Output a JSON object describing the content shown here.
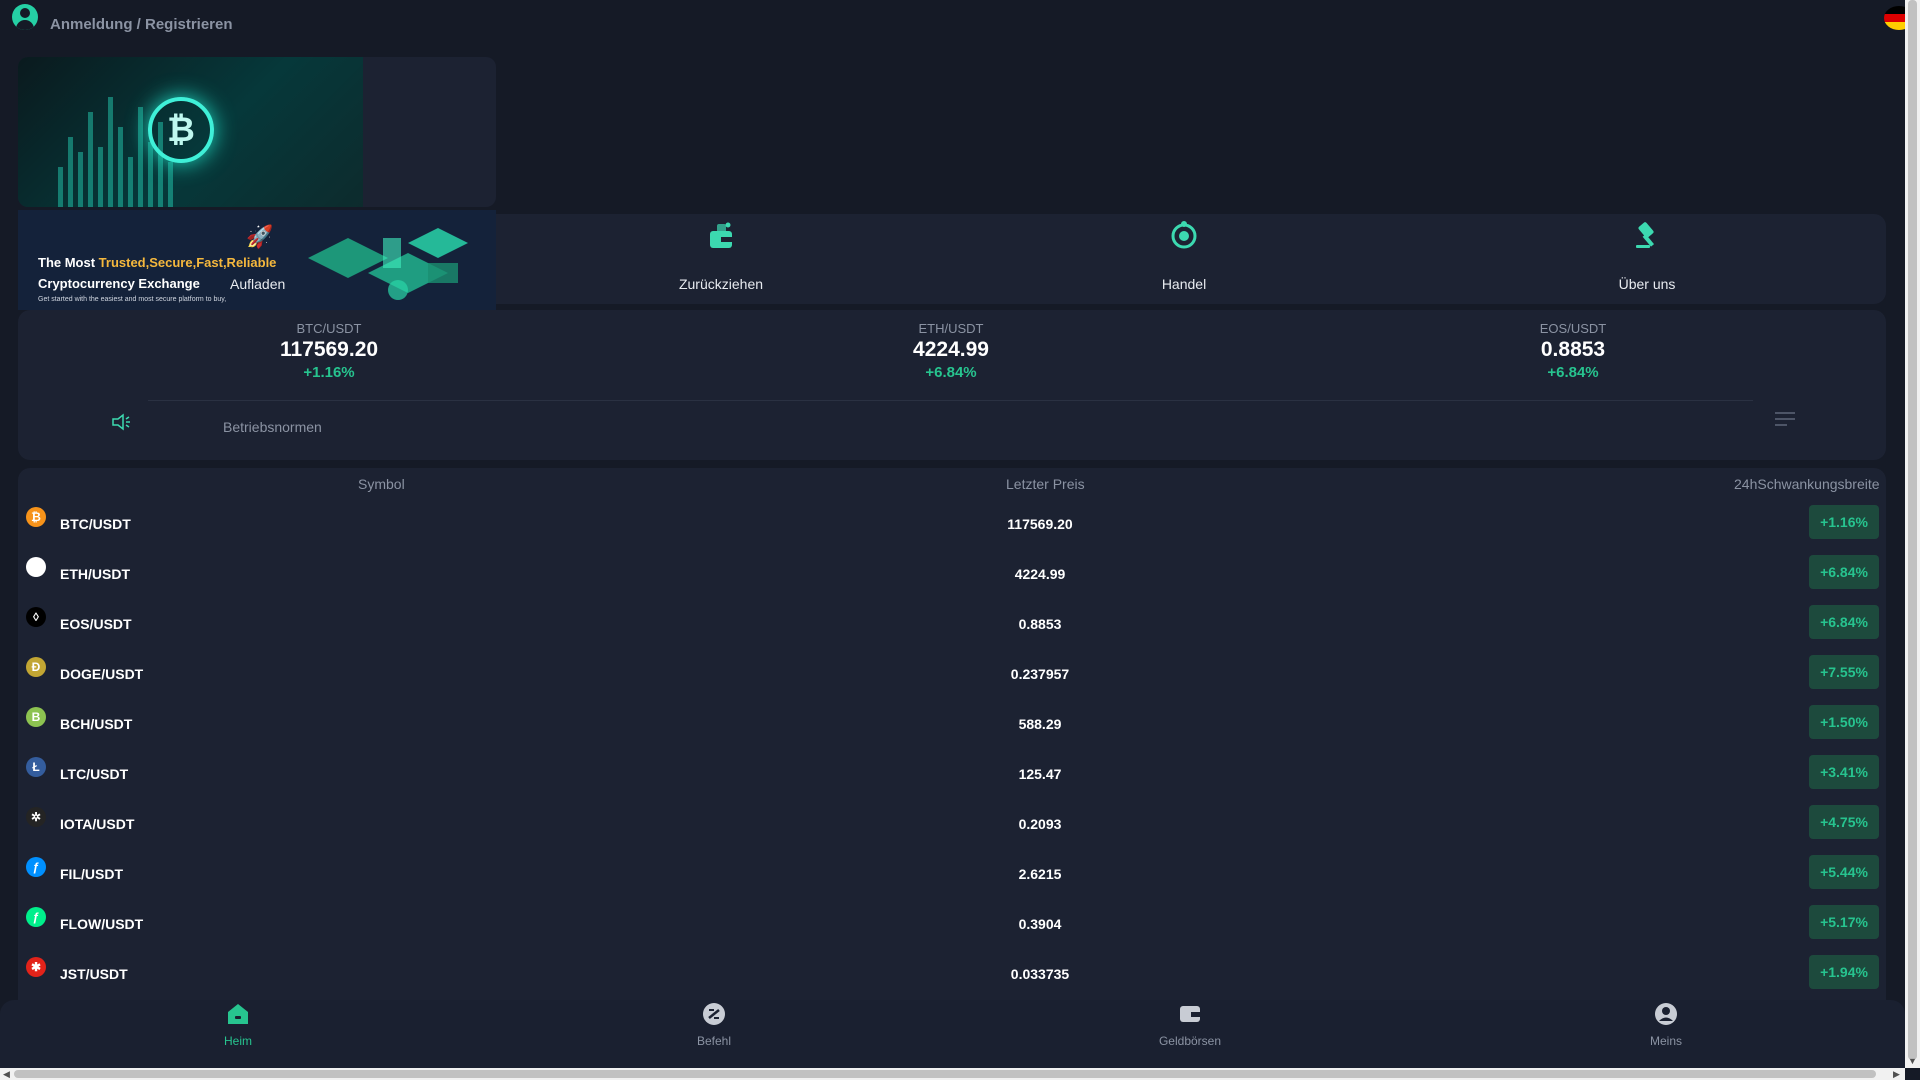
{
  "header": {
    "login_text": "Anmeldung / Registrieren",
    "user_icon": "user-avatar-icon",
    "language_flag": "flag-germany-icon"
  },
  "banner": {
    "coin_symbol": "₿",
    "promo_line1_prefix": "The Most ",
    "promo_line1_highlight": "Trusted,Secure,Fast,Reliable",
    "promo_line2": "Cryptocurrency Exchange",
    "promo_line3": "Get started with the easiest and most secure platform to buy,"
  },
  "actions": [
    {
      "label": "Aufladen",
      "icon": "deposit-rocket-icon"
    },
    {
      "label": "Zurückziehen",
      "icon": "withdraw-wallet-icon"
    },
    {
      "label": "Handel",
      "icon": "trade-icon"
    },
    {
      "label": "Über uns",
      "icon": "about-gavel-icon"
    }
  ],
  "tickers": [
    {
      "pair": "BTC/USDT",
      "price": "117569.20",
      "change": "+1.16%"
    },
    {
      "pair": "ETH/USDT",
      "price": "4224.99",
      "change": "+6.84%"
    },
    {
      "pair": "EOS/USDT",
      "price": "0.8853",
      "change": "+6.84%"
    }
  ],
  "notice": {
    "text": "Betriebsnormen",
    "icon": "speaker-icon",
    "menu_icon": "menu-lines-icon"
  },
  "market": {
    "headers": {
      "symbol": "Symbol",
      "price": "Letzter Preis",
      "change": "24hSchwankungsbreite"
    },
    "rows": [
      {
        "symbol": "BTC/USDT",
        "price": "117569.20",
        "change": "+1.16%",
        "icon": "btc-icon",
        "glyph": "₿",
        "color": "#f7931a"
      },
      {
        "symbol": "ETH/USDT",
        "price": "4224.99",
        "change": "+6.84%",
        "icon": "eth-icon",
        "glyph": "◆",
        "color": "#ffffff"
      },
      {
        "symbol": "EOS/USDT",
        "price": "0.8853",
        "change": "+6.84%",
        "icon": "eos-icon",
        "glyph": "◊",
        "color": "#000000"
      },
      {
        "symbol": "DOGE/USDT",
        "price": "0.237957",
        "change": "+7.55%",
        "icon": "doge-icon",
        "glyph": "Ð",
        "color": "#c2a633"
      },
      {
        "symbol": "BCH/USDT",
        "price": "588.29",
        "change": "+1.50%",
        "icon": "bch-icon",
        "glyph": "B",
        "color": "#8dc351"
      },
      {
        "symbol": "LTC/USDT",
        "price": "125.47",
        "change": "+3.41%",
        "icon": "ltc-icon",
        "glyph": "Ł",
        "color": "#345d9d"
      },
      {
        "symbol": "IOTA/USDT",
        "price": "0.2093",
        "change": "+4.75%",
        "icon": "iota-icon",
        "glyph": "✲",
        "color": "#242424"
      },
      {
        "symbol": "FIL/USDT",
        "price": "2.6215",
        "change": "+5.44%",
        "icon": "fil-icon",
        "glyph": "ƒ",
        "color": "#0090ff"
      },
      {
        "symbol": "FLOW/USDT",
        "price": "0.3904",
        "change": "+5.17%",
        "icon": "flow-icon",
        "glyph": "ƒ",
        "color": "#00ef8b"
      },
      {
        "symbol": "JST/USDT",
        "price": "0.033735",
        "change": "+1.94%",
        "icon": "jst-icon",
        "glyph": "✱",
        "color": "#e2231a"
      }
    ]
  },
  "bottom_nav": [
    {
      "label": "Heim",
      "icon": "home-icon",
      "active": true
    },
    {
      "label": "Befehl",
      "icon": "order-icon",
      "active": false
    },
    {
      "label": "Geldbörsen",
      "icon": "wallet-icon",
      "active": false
    },
    {
      "label": "Meins",
      "icon": "profile-icon",
      "active": false
    }
  ],
  "colors": {
    "background": "#151a26",
    "card": "#1c2232",
    "accent": "#27c48f",
    "badge_bg": "#1d4a3d",
    "muted_text": "#8b93a3"
  }
}
